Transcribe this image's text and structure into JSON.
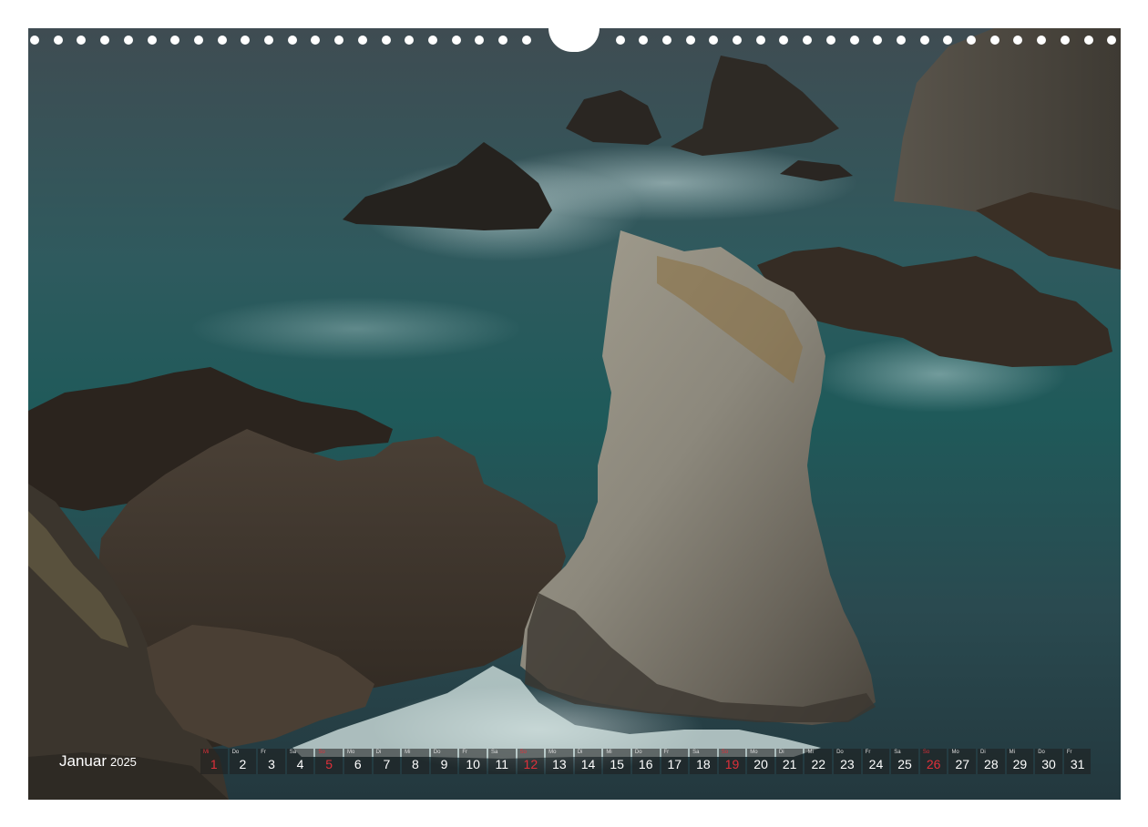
{
  "calendar": {
    "month": "Januar",
    "year": "2025",
    "days": [
      {
        "wd": "Mi",
        "n": "1",
        "sun": true
      },
      {
        "wd": "Do",
        "n": "2"
      },
      {
        "wd": "Fr",
        "n": "3"
      },
      {
        "wd": "Sa",
        "n": "4"
      },
      {
        "wd": "So",
        "n": "5",
        "sun": true
      },
      {
        "wd": "Mo",
        "n": "6"
      },
      {
        "wd": "Di",
        "n": "7"
      },
      {
        "wd": "Mi",
        "n": "8"
      },
      {
        "wd": "Do",
        "n": "9"
      },
      {
        "wd": "Fr",
        "n": "10"
      },
      {
        "wd": "Sa",
        "n": "11"
      },
      {
        "wd": "So",
        "n": "12",
        "sun": true
      },
      {
        "wd": "Mo",
        "n": "13"
      },
      {
        "wd": "Di",
        "n": "14"
      },
      {
        "wd": "Mi",
        "n": "15"
      },
      {
        "wd": "Do",
        "n": "16"
      },
      {
        "wd": "Fr",
        "n": "17"
      },
      {
        "wd": "Sa",
        "n": "18"
      },
      {
        "wd": "So",
        "n": "19",
        "sun": true
      },
      {
        "wd": "Mo",
        "n": "20"
      },
      {
        "wd": "Di",
        "n": "21"
      },
      {
        "wd": "Mi",
        "n": "22"
      },
      {
        "wd": "Do",
        "n": "23"
      },
      {
        "wd": "Fr",
        "n": "24"
      },
      {
        "wd": "Sa",
        "n": "25"
      },
      {
        "wd": "So",
        "n": "26",
        "sun": true
      },
      {
        "wd": "Mo",
        "n": "27"
      },
      {
        "wd": "Di",
        "n": "28"
      },
      {
        "wd": "Mi",
        "n": "29"
      },
      {
        "wd": "Do",
        "n": "30"
      },
      {
        "wd": "Fr",
        "n": "31"
      }
    ]
  },
  "colors": {
    "sunday": "#e0303a",
    "sea": "#1f5a5a",
    "rock_dark": "#2e2a25",
    "rock_light": "#8d8a80"
  }
}
